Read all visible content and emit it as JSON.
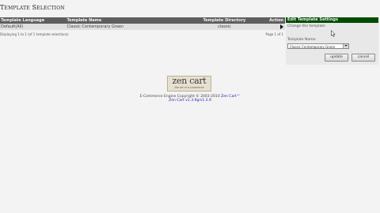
{
  "page": {
    "heading": "Template Selection"
  },
  "table": {
    "headers": [
      "Template Language",
      "Template Name",
      "Template Directory",
      "Action"
    ],
    "rows": [
      {
        "language": "Default(All)",
        "name": "Classic Contemporary Green",
        "directory": "classic"
      }
    ],
    "info": "Displaying 1 to 1 (of 1 template selections)",
    "pages": "Page 1 of 1"
  },
  "sidebox": {
    "title": "Edit Template Settings",
    "description": "Change the template",
    "field_label": "Template Name:",
    "selected_option": "Classic Contemporary Green",
    "update_label": "update",
    "cancel_label": "cancel"
  },
  "logo": {
    "word": "zen cart",
    "tagline": "the art of e-commerce"
  },
  "footer": {
    "copyright": "E-Commerce Engine Copyright © 2003-2010",
    "copyright_link": "Zen Cart™",
    "version": "Zen Cart v1.3.9g/v1.3.9"
  },
  "colors": {
    "header_bg": "#5f5f5f",
    "sidebox_header_bg": "#004d00",
    "link": "#1a1ab5"
  }
}
